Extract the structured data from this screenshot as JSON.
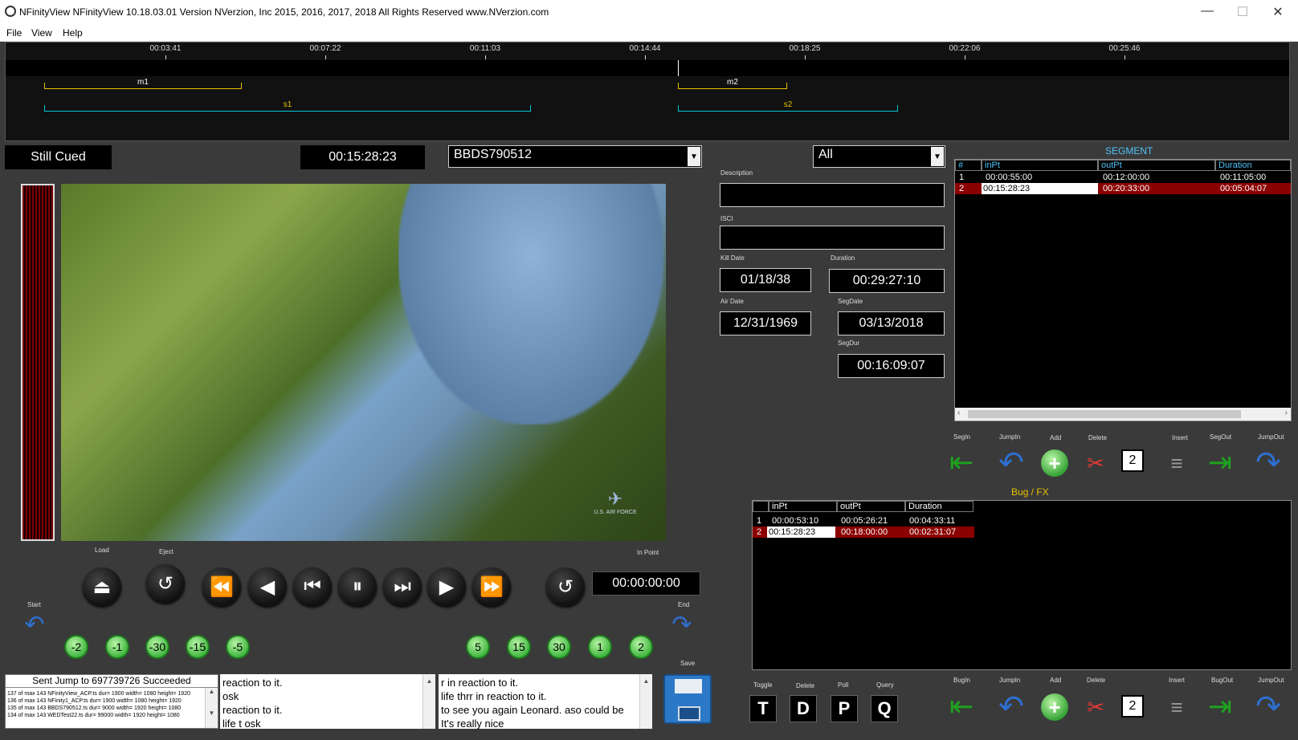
{
  "window": {
    "title": "NFinityView NFinityView 10.18.03.01 Version NVerzion, Inc 2015, 2016, 2017, 2018  All Rights Reserved  www.NVerzion.com",
    "minimize": "—",
    "maximize": "☐",
    "close": "✕"
  },
  "menu": {
    "file": "File",
    "view": "View",
    "help": "Help"
  },
  "timeline": {
    "ticks": [
      "00:03:41",
      "00:07:22",
      "00:11:03",
      "00:14:44",
      "00:18:25",
      "00:22:06",
      "00:25:46"
    ],
    "markers": [
      {
        "label": "m1"
      },
      {
        "label": "s1"
      },
      {
        "label": "m2"
      },
      {
        "label": "s2"
      }
    ],
    "colors": {
      "marker": "#e6c200",
      "segment": "#00c8d6"
    }
  },
  "status": "Still Cued",
  "timecode": "00:15:28:23",
  "clip_select": {
    "value": "BBDS790512"
  },
  "filter_select": {
    "value": "All"
  },
  "metadata": {
    "description_label": "Description",
    "description": "",
    "isci_label": "ISCI",
    "isci": "",
    "kill_date_label": "Kill Date",
    "kill_date": "01/18/38",
    "duration_label": "Duration",
    "duration": "00:29:27:10",
    "air_date_label": "Air Date",
    "air_date": "12/31/1969",
    "seg_date_label": "SegDate",
    "seg_date": "03/13/2018",
    "seg_dur_label": "SegDur",
    "seg_dur": "00:16:09:07"
  },
  "segment": {
    "title": "SEGMENT",
    "columns": [
      "#",
      "inPt",
      "outPt",
      "Duration"
    ],
    "rows": [
      {
        "n": "1",
        "in": "00:00:55:00",
        "out": "00:12:00:00",
        "dur": "00:11:05:00"
      },
      {
        "n": "2",
        "in": "00:15:28:23",
        "out": "00:20:33:00",
        "dur": "00:05:04:07"
      }
    ]
  },
  "seg_controls": {
    "segin": "SegIn",
    "jumpin": "JumpIn",
    "add": "Add",
    "delete": "Delete",
    "insert": "Insert",
    "segout": "SegOut",
    "jumpout": "JumpOut",
    "count": "2"
  },
  "bug": {
    "title": "Bug / FX",
    "columns": [
      "inPt",
      "outPt",
      "Duration"
    ],
    "rows": [
      {
        "n": "1",
        "in": "00:00:53:10",
        "out": "00:05:26:21",
        "dur": "00:04:33:11"
      },
      {
        "n": "2",
        "in": "00:15:28:23",
        "out": "00:18:00:00",
        "dur": "00:02:31:07"
      }
    ]
  },
  "bug_controls": {
    "bugin": "BugIn",
    "jumpin": "JumpIn",
    "add": "Add",
    "delete": "Delete",
    "insert": "Insert",
    "bugout": "BugOut",
    "jumpout": "JumpOut",
    "count": "2"
  },
  "transport": {
    "load": "Load",
    "eject": "Eject",
    "in_point_label": "In Point",
    "in_point": "00:00:00:00",
    "start": "Start",
    "end": "End",
    "save": "Save"
  },
  "jog_back": [
    "-2",
    "-1",
    "-30",
    "-15",
    "-5"
  ],
  "jog_fwd": [
    "5",
    "15",
    "30",
    "1",
    "2"
  ],
  "log": {
    "header": "Sent Jump to 697739726 Succeeded",
    "lines": [
      "137 of max 143 NFinityView_ACP.ts dur= 1900 width= 1080 height= 1920",
      "136 of max 143 NFinity1_ACP.ts dur= 1900 width= 1080 height= 1920",
      "135 of max 143 BBDS790512.ts dur= 9000 width= 1920 height= 1080",
      "134 of max 143 WEDTest22.ts dur= 99000 width= 1920 height= 1080"
    ]
  },
  "captions1": [
    "reaction to it.",
    " osk",
    "reaction to it.",
    "life t osk"
  ],
  "captions2": [
    " r in reaction to it.",
    " life thrr in reaction to it.",
    "to see you again Leonard. aso could be",
    "It's really nice"
  ],
  "toggles": {
    "toggle": "Toggle",
    "delete": "Delete",
    "poll": "Poll",
    "query": "Query",
    "t": "T",
    "d": "D",
    "p": "P",
    "q": "Q"
  },
  "watermark": "U.S. AIR FORCE"
}
